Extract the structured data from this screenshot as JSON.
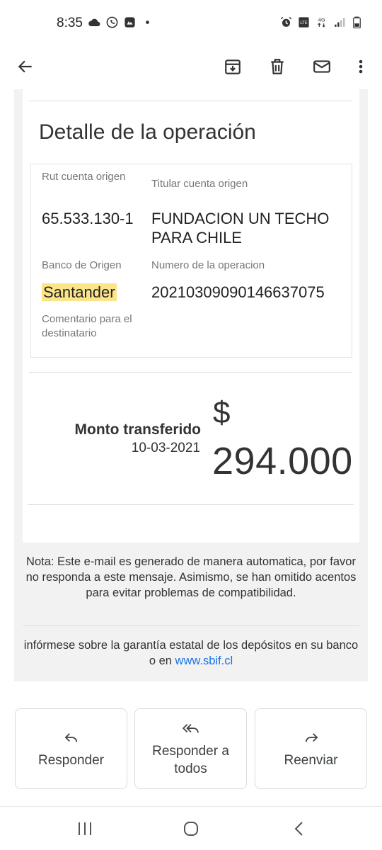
{
  "status_bar": {
    "time": "8:35",
    "left_icons": [
      "cloud-icon",
      "whatsapp-icon",
      "app-icon",
      "dot-icon"
    ],
    "right_icons": [
      "alarm-icon",
      "volte-icon",
      "4g-icon",
      "signal-icon",
      "battery-icon"
    ]
  },
  "app_bar": {
    "icons": [
      "back-arrow-icon",
      "archive-icon",
      "delete-icon",
      "mail-icon",
      "more-vert-icon"
    ]
  },
  "email": {
    "section_title": "Detalle de la operación",
    "details": {
      "rut_label": "Rut cuenta origen",
      "rut_value": "65.533.130-1",
      "titular_label": "Titular cuenta origen",
      "titular_value": "FUNDACION UN TECHO PARA CHILE",
      "banco_label": "Banco de Origen",
      "banco_value": "Santander",
      "numero_label": "Numero de la operacion",
      "numero_value": "20210309090146637075",
      "comentario_label": "Comentario para el destinatario"
    },
    "amount": {
      "label": "Monto transferido",
      "date": "10-03-2021",
      "currency": "$",
      "value": "294.000"
    },
    "note": "Nota: Este e-mail es generado de manera automatica, por favor no responda a este mensaje. Asimismo, se han omitido acentos para evitar problemas de compatibilidad.",
    "guarantee_text": "infórmese sobre la garantía estatal de los depósitos en su banco o en",
    "guarantee_link": "www.sbif.cl"
  },
  "actions": {
    "reply": "Responder",
    "reply_all": "Responder a todos",
    "forward": "Reenviar"
  },
  "nav_bar": {
    "icons": [
      "recent-apps-icon",
      "home-icon",
      "back-icon"
    ]
  },
  "colors": {
    "highlight": "#fce588",
    "link": "#1a73e8",
    "email_background": "#f2f2f2"
  }
}
